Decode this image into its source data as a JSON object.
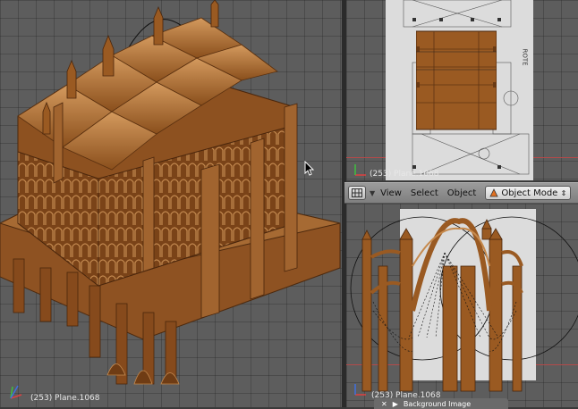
{
  "viewports": {
    "main": {
      "object_label": "(253) Plane.1068"
    },
    "top": {
      "object_label": "(253) Plane.1068",
      "reference_text": "ROTE"
    },
    "side": {
      "object_label": "(253) Plane.1068"
    }
  },
  "header": {
    "menu_items": [
      "View",
      "Select",
      "Object"
    ],
    "mode": "Object Mode"
  },
  "background_panel": {
    "label": "Background Image",
    "close_glyph": "✕",
    "expand_glyph": "▶"
  },
  "colors": {
    "model_brown": "#9a5a22",
    "model_highlight": "#c68a4e",
    "model_shadow": "#5e3413",
    "grid_bg": "#5d5d5d"
  },
  "icons": [
    "grid-editor-icon",
    "mode-icon",
    "cursor-icon",
    "axis-gizmo-icon"
  ]
}
